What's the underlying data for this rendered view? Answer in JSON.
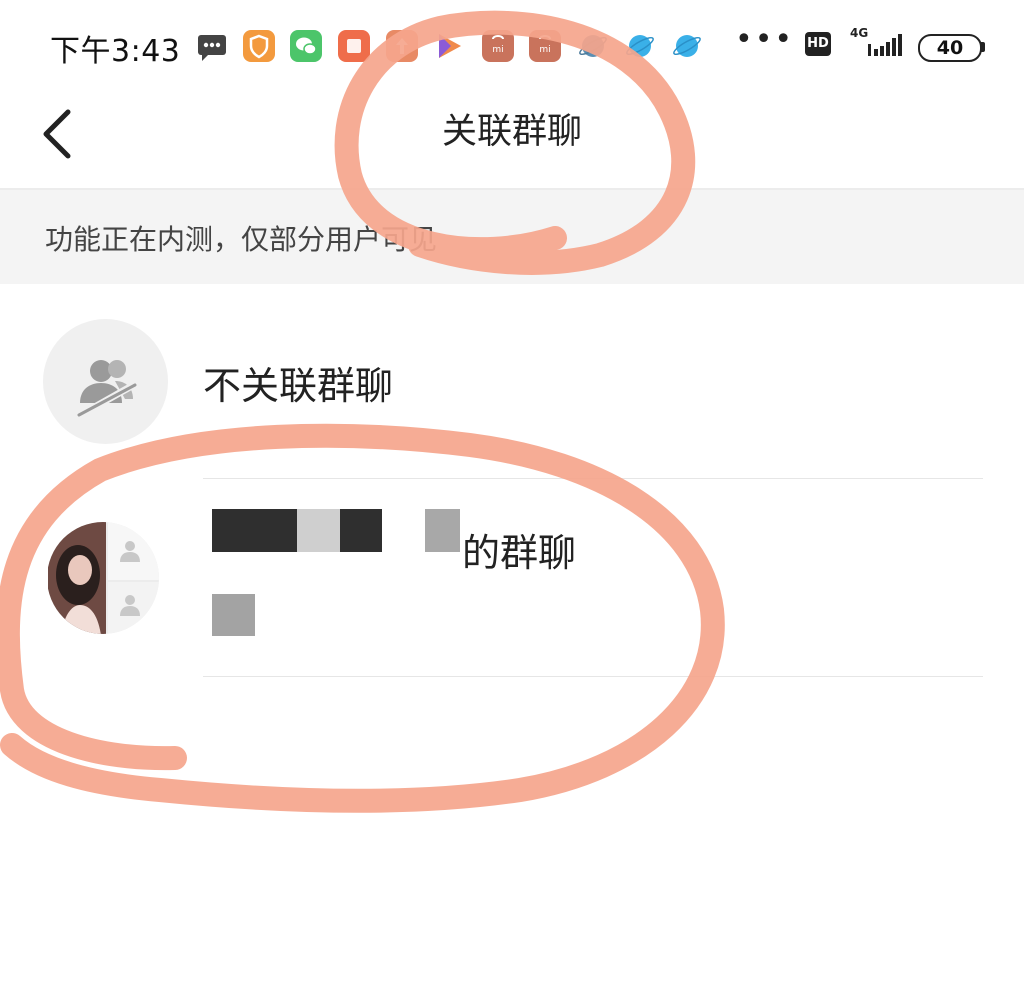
{
  "status_bar": {
    "time": "下午3:43",
    "hd_label": "HD",
    "network_label": "4G",
    "battery_level": "40",
    "overflow_indicator": "•••",
    "notification_icons": [
      "message-icon",
      "shield-app-icon",
      "wechat-app-icon",
      "orange-app-icon",
      "upload-app-icon",
      "video-play-app-icon",
      "mi-store-app-icon",
      "mi-store-app-icon",
      "planet-app-icon",
      "planet-app-icon",
      "planet-app-icon"
    ]
  },
  "header": {
    "title": "关联群聊",
    "back_icon": "chevron-left-icon"
  },
  "notice": {
    "text": "功能正在内测，仅部分用户可见"
  },
  "list": {
    "items": [
      {
        "label": "不关联群聊",
        "icon": "user-slash-icon"
      },
      {
        "label_suffix": "的群聊",
        "icon": "group-avatar"
      }
    ]
  },
  "colors": {
    "annotation": "#f5a58c",
    "notice_bg": "#f4f4f4",
    "divider": "#e6e6e6"
  }
}
